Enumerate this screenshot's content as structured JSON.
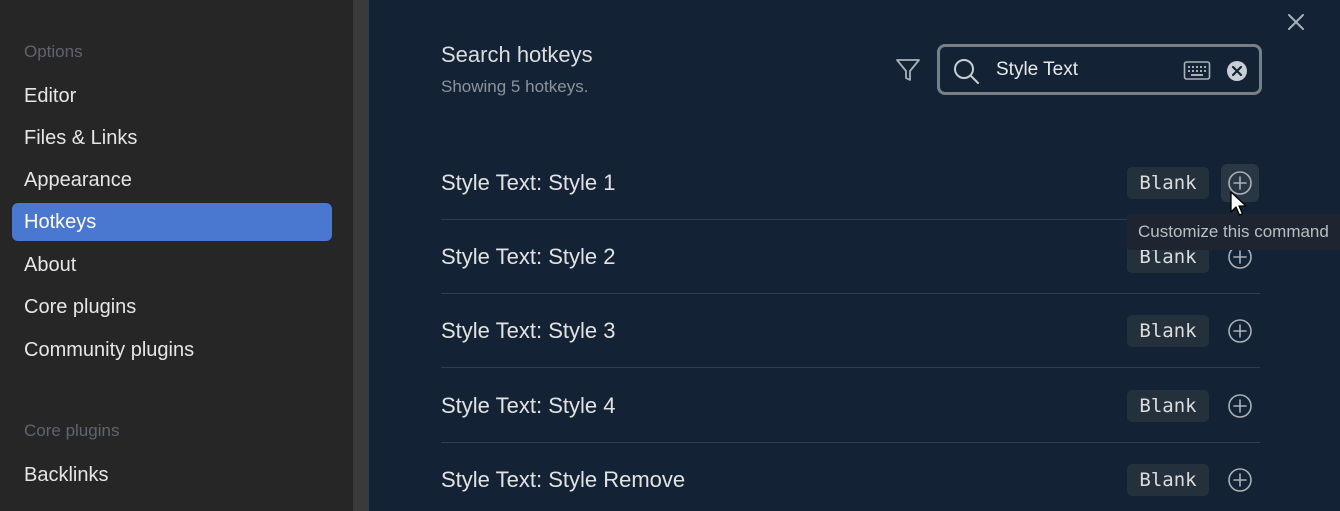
{
  "sidebar": {
    "options_heading": "Options",
    "items": [
      {
        "label": "Editor"
      },
      {
        "label": "Files & Links"
      },
      {
        "label": "Appearance"
      },
      {
        "label": "Hotkeys",
        "active": true
      },
      {
        "label": "About"
      },
      {
        "label": "Core plugins"
      },
      {
        "label": "Community plugins"
      }
    ],
    "core_heading": "Core plugins",
    "core_items": [
      {
        "label": "Backlinks"
      }
    ]
  },
  "main": {
    "close_icon": "close-icon",
    "title": "Search hotkeys",
    "subtitle": "Showing 5 hotkeys.",
    "filter_icon": "filter-icon",
    "search": {
      "value": "Style Text",
      "search_icon": "search-icon",
      "keyboard_icon": "keyboard-icon",
      "clear_icon": "clear-icon"
    },
    "hotkeys": [
      {
        "label": "Style Text: Style 1",
        "hotkey": "Blank"
      },
      {
        "label": "Style Text: Style 2",
        "hotkey": "Blank"
      },
      {
        "label": "Style Text: Style 3",
        "hotkey": "Blank"
      },
      {
        "label": "Style Text: Style 4",
        "hotkey": "Blank"
      },
      {
        "label": "Style Text: Style Remove",
        "hotkey": "Blank"
      }
    ],
    "tooltip": "Customize this command"
  },
  "colors": {
    "accent": "#4a78d0",
    "background": "#132335",
    "sidebar": "#262626"
  }
}
